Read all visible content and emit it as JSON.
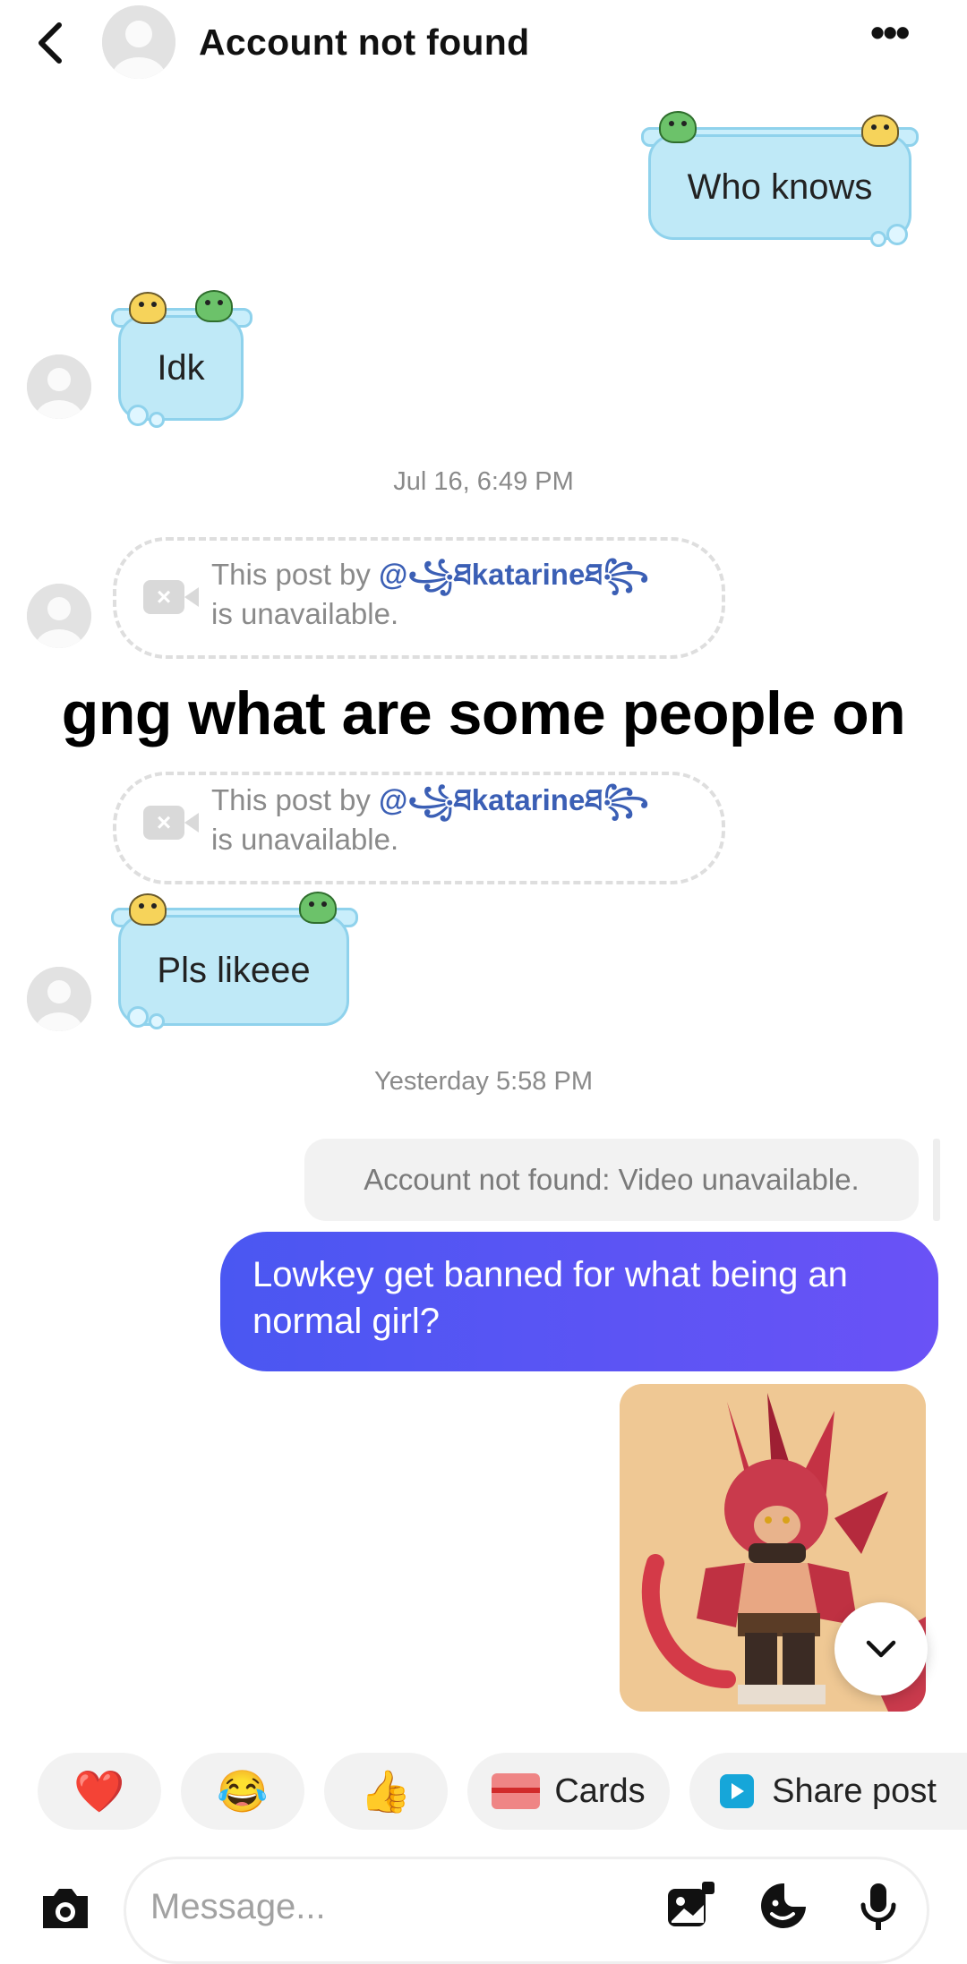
{
  "header": {
    "title": "Account not found",
    "more_label": "•••"
  },
  "messages": {
    "sticker_out_1": "Who knows",
    "sticker_in_1": "Idk",
    "timestamp_1": "Jul 16, 6:49 PM",
    "post_1": {
      "prefix": "This post by ",
      "handle": "@꧁ཐkatarineཐ꧂",
      "suffix": "is unavailable."
    },
    "caption": "gng what are some people on",
    "post_2": {
      "prefix": "This post by ",
      "handle": "@꧁ཐkatarineཐ꧂",
      "suffix": "is unavailable."
    },
    "sticker_in_2": "Pls likeee",
    "timestamp_2": "Yesterday 5:58 PM",
    "notice": "Account not found: Video unavailable.",
    "my_message": "Lowkey get banned for what being an normal girl?"
  },
  "quick_replies": {
    "heart": "❤️",
    "laugh": "😂",
    "thumbs": "👍",
    "cards": "Cards",
    "share": "Share post"
  },
  "composer": {
    "placeholder": "Message..."
  },
  "colors": {
    "sticker_bubble": "#bfe9f7",
    "my_bubble_start": "#4a57f2",
    "my_bubble_end": "#6a52f6",
    "handle": "#3b5fb5"
  }
}
